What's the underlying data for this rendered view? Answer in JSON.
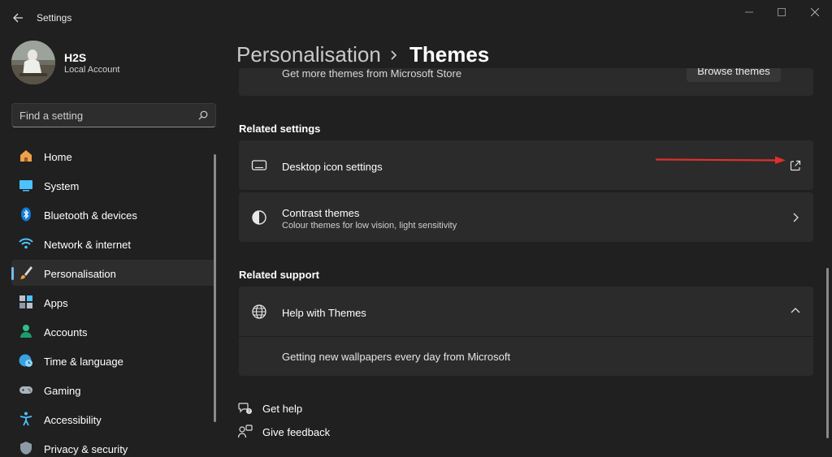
{
  "window": {
    "title": "Settings",
    "back_icon": "back-arrow-icon",
    "controls": [
      "minimize-icon",
      "maximize-icon",
      "close-icon"
    ]
  },
  "user": {
    "name": "H2S",
    "account_type": "Local Account"
  },
  "search": {
    "placeholder": "Find a setting",
    "icon": "search-icon"
  },
  "sidebar": {
    "items": [
      {
        "label": "Home",
        "icon": "home-icon"
      },
      {
        "label": "System",
        "icon": "system-icon"
      },
      {
        "label": "Bluetooth & devices",
        "icon": "bluetooth-icon"
      },
      {
        "label": "Network & internet",
        "icon": "wifi-icon"
      },
      {
        "label": "Personalisation",
        "icon": "brush-icon",
        "selected": true
      },
      {
        "label": "Apps",
        "icon": "apps-icon"
      },
      {
        "label": "Accounts",
        "icon": "accounts-icon"
      },
      {
        "label": "Time & language",
        "icon": "time-language-icon"
      },
      {
        "label": "Gaming",
        "icon": "gaming-icon"
      },
      {
        "label": "Accessibility",
        "icon": "accessibility-icon"
      },
      {
        "label": "Privacy & security",
        "icon": "shield-icon"
      }
    ]
  },
  "breadcrumb": {
    "parent": "Personalisation",
    "current": "Themes"
  },
  "main": {
    "store_row": {
      "label": "Get more themes from Microsoft Store",
      "button": "Browse themes"
    },
    "related_settings": {
      "title": "Related settings",
      "items": [
        {
          "title": "Desktop icon settings",
          "icon": "monitor-icon",
          "end_icon": "open-external-icon"
        },
        {
          "title": "Contrast themes",
          "subtitle": "Colour themes for low vision, light sensitivity",
          "icon": "contrast-icon",
          "end_icon": "chevron-right-icon"
        }
      ]
    },
    "related_support": {
      "title": "Related support",
      "help_title": "Help with Themes",
      "help_icon": "globe-icon",
      "expanded": true,
      "links": [
        "Getting new wallpapers every day from Microsoft"
      ]
    },
    "footer_links": [
      {
        "label": "Get help",
        "icon": "get-help-icon"
      },
      {
        "label": "Give feedback",
        "icon": "feedback-icon"
      }
    ]
  },
  "annotation": {
    "arrow_color": "#e0302a"
  },
  "colors": {
    "background": "#202020",
    "card": "#2b2b2b",
    "accent": "#76b9ed"
  }
}
